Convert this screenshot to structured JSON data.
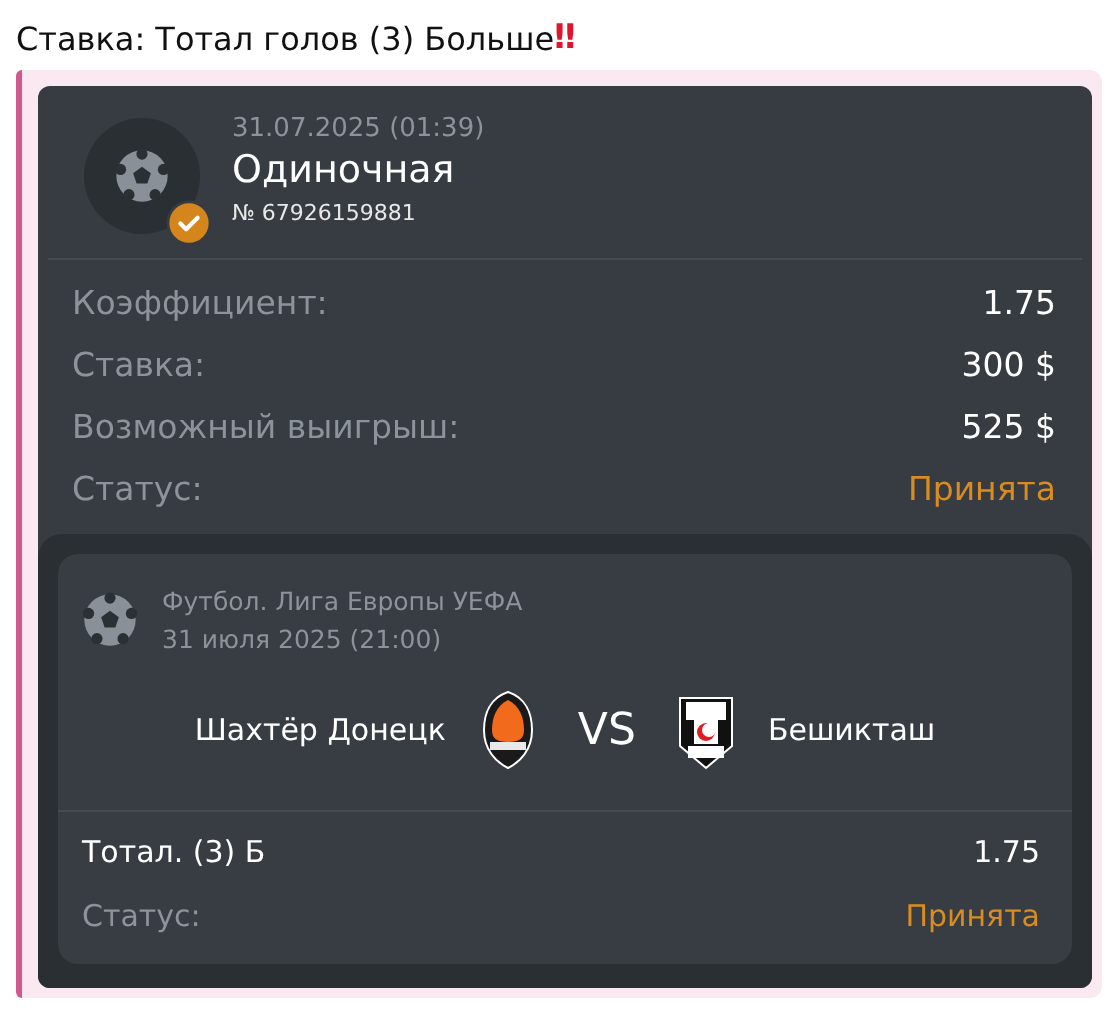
{
  "message": {
    "title": "Ставка: Тотал голов (3) Больше",
    "alert": "‼"
  },
  "bet": {
    "date": "31.07.2025 (01:39)",
    "type": "Одиночная",
    "number": "№ 67926159881",
    "confirmed": true,
    "rows": [
      {
        "kind": "amount",
        "label": "Коэффициент:",
        "value": "1.75"
      },
      {
        "kind": "amount",
        "label": "Ставка:",
        "value": "300 $"
      },
      {
        "kind": "amount",
        "label": "Возможный выигрыш:",
        "value": "525 $"
      },
      {
        "kind": "status",
        "label": "Статус:",
        "value": "Принята"
      }
    ]
  },
  "event": {
    "league": "Футбол. Лига Европы УЕФА",
    "date": "31 июля 2025 (21:00)",
    "home": "Шахтёр Донецк",
    "vs": "VS",
    "away": "Бешикташ",
    "selection": {
      "label": "Тотал. (3) Б",
      "odds": "1.75"
    },
    "status": {
      "kind": "status",
      "label": "Статус:",
      "value": "Принята"
    }
  }
}
